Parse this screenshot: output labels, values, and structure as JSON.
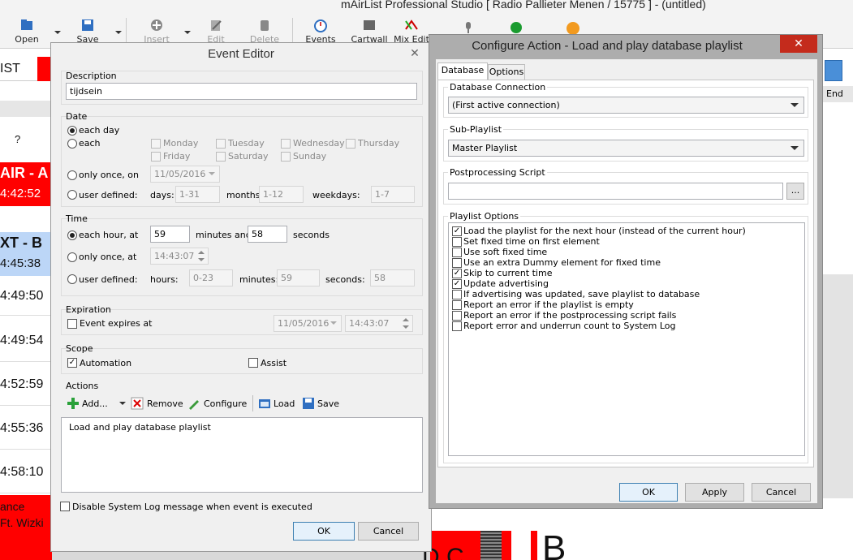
{
  "app": {
    "title": "mAirList Professional Studio [ Radio Pallieter Menen / 15775 ] - (untitled)",
    "toolbar": [
      {
        "label": "Open",
        "icon": "folder-icon",
        "enabled": true
      },
      {
        "label": "Save",
        "icon": "floppy-icon",
        "enabled": true
      },
      {
        "label": "Insert",
        "icon": "insert-icon",
        "enabled": false
      },
      {
        "label": "Edit",
        "icon": "edit-icon",
        "enabled": false
      },
      {
        "label": "Delete",
        "icon": "delete-icon",
        "enabled": false
      },
      {
        "label": "Events",
        "icon": "clock-icon",
        "enabled": true
      },
      {
        "label": "Cartwall",
        "icon": "cartwall-icon",
        "enabled": true
      },
      {
        "label": "Mix Edit",
        "icon": "mix-icon",
        "enabled": true
      }
    ],
    "left_strip": {
      "header": "IST",
      "question": "?",
      "onair_label": "AIR - A",
      "onair_time": "4:42:52",
      "next_label": "XT - B",
      "next_time": "4:45:38",
      "times": [
        "4:49:50",
        "4:49:54",
        "4:52:59",
        "4:55:36",
        "4:58:10"
      ],
      "bottom_1": "ance",
      "bottom_2": "Ft. Wizki"
    },
    "right_strip": {
      "end_label": "End"
    },
    "bottom_right_letter": "B",
    "bottom_partial": "D C"
  },
  "event_editor": {
    "title": "Event Editor",
    "description_label": "Description",
    "description_value": "tijdsein",
    "date": {
      "label": "Date",
      "each_day": "each day",
      "each": "each",
      "days": [
        "Monday",
        "Tuesday",
        "Wednesday",
        "Thursday",
        "Friday",
        "Saturday",
        "Sunday"
      ],
      "only_once_on": "only once, on",
      "once_date": "11/05/2016",
      "user_defined": "user defined:",
      "days_label": "days:",
      "days_value": "1-31",
      "months_label": "months:",
      "months_value": "1-12",
      "weekdays_label": "weekdays:",
      "weekdays_value": "1-7"
    },
    "time": {
      "label": "Time",
      "each_hour_at": "each hour, at",
      "minutes_value": "59",
      "minutes_and": "minutes and",
      "seconds_value": "58",
      "seconds": "seconds",
      "only_once_at": "only once, at",
      "once_time": "14:43:07",
      "user_defined": "user defined:",
      "hours_label": "hours:",
      "hours_value": "0-23",
      "minutes_label": "minutes:",
      "minutes_ud_value": "59",
      "seconds_label": "seconds:",
      "seconds_ud_value": "58"
    },
    "expiration": {
      "label": "Expiration",
      "expires_at": "Event expires at",
      "date": "11/05/2016",
      "time": "14:43:07"
    },
    "scope": {
      "label": "Scope",
      "automation": "Automation",
      "assist": "Assist"
    },
    "actions": {
      "label": "Actions",
      "add": "Add...",
      "remove": "Remove",
      "configure": "Configure",
      "load": "Load",
      "save": "Save",
      "items": [
        "Load and play database playlist"
      ]
    },
    "disable_log": "Disable System Log message when event is executed",
    "ok": "OK",
    "cancel": "Cancel"
  },
  "configure_action": {
    "title": "Configure Action - Load and play database playlist",
    "tabs": [
      "Database",
      "Options"
    ],
    "db_connection_label": "Database Connection",
    "db_connection_value": "(First active connection)",
    "sub_playlist_label": "Sub-Playlist",
    "sub_playlist_value": "Master Playlist",
    "postprocessing_label": "Postprocessing Script",
    "postprocessing_value": "",
    "browse_label": "...",
    "playlist_options_label": "Playlist Options",
    "options": [
      {
        "label": "Load the playlist for the next hour (instead of the current hour)",
        "checked": true
      },
      {
        "label": "Set fixed time on first element",
        "checked": false
      },
      {
        "label": "Use soft fixed time",
        "checked": false
      },
      {
        "label": "Use an extra Dummy element for fixed time",
        "checked": false
      },
      {
        "label": "Skip to current time",
        "checked": true
      },
      {
        "label": "Update advertising",
        "checked": true
      },
      {
        "label": "If advertising was updated, save playlist to database",
        "checked": false
      },
      {
        "label": "Report an error if the playlist is empty",
        "checked": false
      },
      {
        "label": "Report an error if the postprocessing script fails",
        "checked": false
      },
      {
        "label": "Report error and underrun count to System Log",
        "checked": false
      }
    ],
    "ok": "OK",
    "apply": "Apply",
    "cancel": "Cancel"
  },
  "colors": {
    "accent_red": "#ff0000",
    "close_red": "#c42b1c",
    "selection_blue": "#bcd6f7"
  }
}
